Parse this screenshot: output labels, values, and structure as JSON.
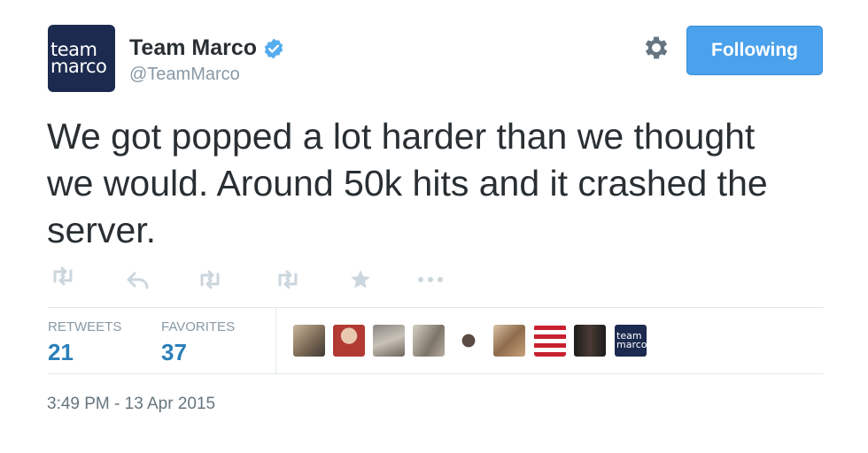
{
  "account": {
    "display_name": "Team Marco",
    "handle": "@TeamMarco",
    "avatar_line1": "team",
    "avatar_line2": "marco",
    "verified": true
  },
  "follow_button": {
    "label": "Following"
  },
  "tweet": {
    "line1": "We got popped a lot harder than we thought",
    "line2": "we would. Around 50k hits and it crashed the",
    "line3": "server."
  },
  "actions": [
    "retweet-icon",
    "reply-icon",
    "retweet-icon",
    "retweet-icon",
    "favorite-icon",
    "more-icon"
  ],
  "stats": {
    "retweets_label": "RETWEETS",
    "retweets_value": "21",
    "favorites_label": "FAVORITES",
    "favorites_value": "37"
  },
  "favoriters": {
    "last_avatar_line1": "team",
    "last_avatar_line2": "marco"
  },
  "timestamp": "3:49 PM - 13 Apr 2015",
  "colors": {
    "accent": "#4aa1ec",
    "stat_value": "#2a7fb8",
    "muted": "#8899a6",
    "avatar_bg": "#1b2a4e"
  }
}
